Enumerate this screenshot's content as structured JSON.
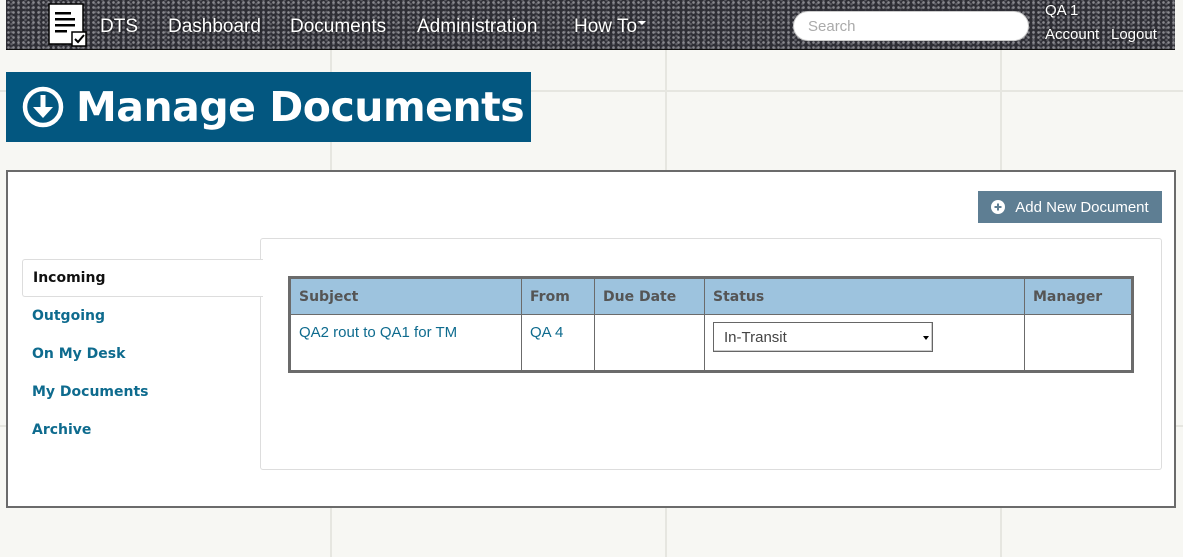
{
  "navbar": {
    "brand": "DTS",
    "items": [
      "Dashboard",
      "Documents",
      "Administration",
      "How To"
    ],
    "search_placeholder": "Search",
    "user_name": "QA 1",
    "account": "Account",
    "logout": "Logout",
    "icons": {
      "logo": "document-check-icon",
      "caret": "caret-down-icon"
    }
  },
  "page": {
    "title": "Manage Documents",
    "title_icon": "arrow-circle-down-icon",
    "add_button": "Add New Document",
    "add_icon": "plus-circle-icon"
  },
  "side_tabs": [
    "Incoming",
    "Outgoing",
    "On My Desk",
    "My Documents",
    "Archive"
  ],
  "active_tab": "Incoming",
  "table": {
    "columns": [
      "Subject",
      "From",
      "Due Date",
      "Status",
      "Manager"
    ],
    "rows": [
      {
        "subject": "QA2 rout to QA1 for TM",
        "from": "QA 4",
        "due_date": "",
        "status": "In-Transit",
        "manager": ""
      }
    ]
  },
  "colors": {
    "title_bg": "#035780",
    "link": "#0e6b8e",
    "button_bg": "#5e7e93",
    "table_header_bg": "#9dc3de"
  }
}
